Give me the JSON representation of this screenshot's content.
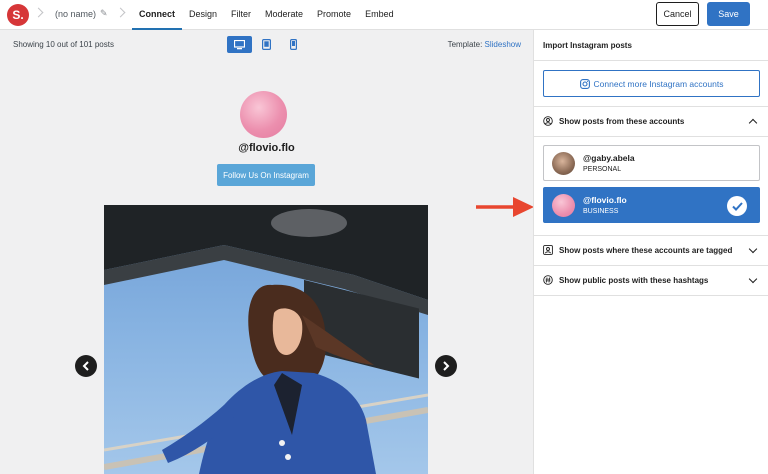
{
  "topbar": {
    "logo_text": "S.",
    "feed_name": "(no name)",
    "tabs": [
      {
        "label": "Connect",
        "active": true
      },
      {
        "label": "Design",
        "active": false
      },
      {
        "label": "Filter",
        "active": false
      },
      {
        "label": "Moderate",
        "active": false
      },
      {
        "label": "Promote",
        "active": false
      },
      {
        "label": "Embed",
        "active": false
      }
    ],
    "cancel_label": "Cancel",
    "save_label": "Save"
  },
  "preview": {
    "showing_text": "Showing 10 out of 101 posts",
    "devices": [
      "desktop-icon",
      "tablet-icon",
      "phone-icon"
    ],
    "active_device": "desktop",
    "template_label": "Template:",
    "template_value": "Slideshow",
    "handle": "@flovio.flo",
    "follow_label": "Follow Us On Instagram"
  },
  "sidebar": {
    "title": "Import Instagram posts",
    "connect_label": "Connect more Instagram accounts",
    "sections": {
      "accounts": {
        "label": "Show posts from these accounts",
        "expanded": true
      },
      "tagged": {
        "label": "Show posts where these accounts are tagged",
        "expanded": false
      },
      "hashtags": {
        "label": "Show public posts with these hashtags",
        "expanded": false
      }
    },
    "accounts": [
      {
        "name": "@gaby.abela",
        "type": "PERSONAL",
        "selected": false
      },
      {
        "name": "@flovio.flo",
        "type": "BUSINESS",
        "selected": true
      }
    ]
  },
  "colors": {
    "accent": "#3073c4",
    "logo": "#d63638",
    "pointer_arrow": "#e8462f",
    "follow_button": "#5aa6d8"
  }
}
